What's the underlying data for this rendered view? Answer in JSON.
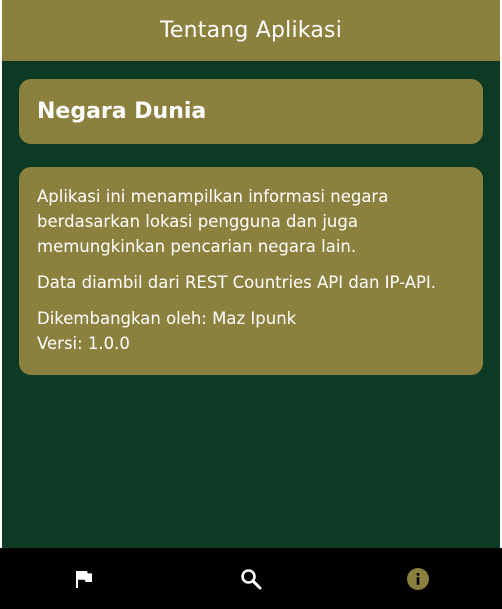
{
  "appbar": {
    "title": "Tentang Aplikasi"
  },
  "title_card": {
    "title": "Negara Dunia"
  },
  "info_card": {
    "description": "Aplikasi ini menampilkan informasi negara berdasarkan lokasi pengguna dan juga memungkinkan pencarian negara lain.",
    "data_source": "Data diambil dari REST Countries API dan IP-API.",
    "developer": "Dikembangkan oleh: Maz Ipunk",
    "version": "Versi: 1.0.0"
  },
  "bottom_nav": {
    "items": [
      {
        "icon": "flag-icon",
        "active": false
      },
      {
        "icon": "search-icon",
        "active": false
      },
      {
        "icon": "info-icon",
        "active": true
      }
    ],
    "active_color": "#8c803e",
    "inactive_color": "#ffffff"
  },
  "colors": {
    "background": "#0c3a25",
    "accent": "#8c803e",
    "text": "#ffffff",
    "nav_background": "#000000"
  }
}
